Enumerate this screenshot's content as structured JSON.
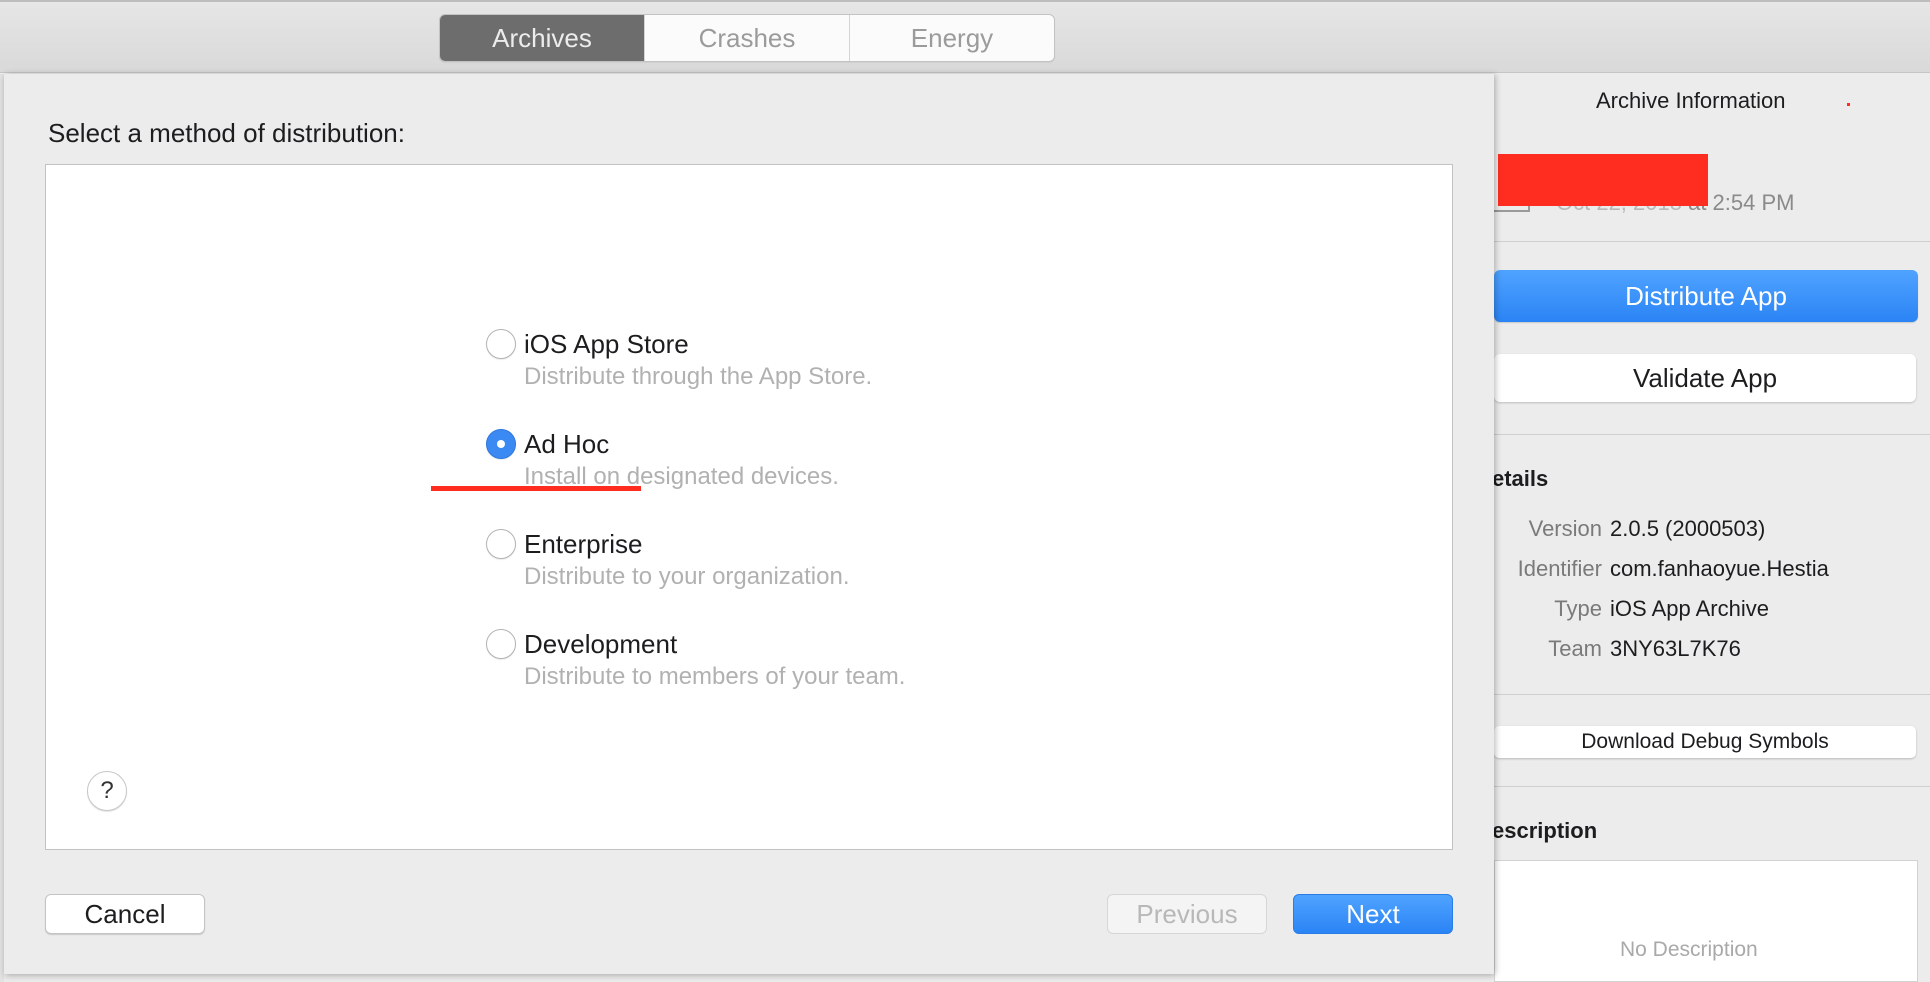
{
  "toolbar": {
    "tabs": [
      {
        "label": "Archives",
        "active": true
      },
      {
        "label": "Crashes",
        "active": false
      },
      {
        "label": "Energy",
        "active": false
      }
    ]
  },
  "sheet": {
    "title": "Select a method of distribution:",
    "options": [
      {
        "title": "iOS App Store",
        "description": "Distribute through the App Store.",
        "selected": false
      },
      {
        "title": "Ad Hoc",
        "description": "Install on designated devices.",
        "selected": true
      },
      {
        "title": "Enterprise",
        "description": "Distribute to your organization.",
        "selected": false
      },
      {
        "title": "Development",
        "description": "Distribute to members of your team.",
        "selected": false
      }
    ],
    "help_label": "?",
    "cancel_label": "Cancel",
    "previous_label": "Previous",
    "next_label": "Next"
  },
  "archive_panel": {
    "title": "Archive Information",
    "date_visible": "at 2:54 PM",
    "distribute_label": "Distribute App",
    "validate_label": "Validate App",
    "details_heading": "etails",
    "details": [
      {
        "label": "Version",
        "value": "2.0.5 (2000503)"
      },
      {
        "label": "Identifier",
        "value": "com.fanhaoyue.Hestia"
      },
      {
        "label": "Type",
        "value": "iOS App Archive"
      },
      {
        "label": "Team",
        "value": "3NY63L7K76"
      }
    ],
    "debug_symbols_label": "Download Debug Symbols",
    "description_heading": "escription",
    "no_description": "No Description"
  },
  "colors": {
    "accent_blue": "#2b84f5",
    "annotation_red": "#ff2d20"
  },
  "icons": {
    "help": "question-icon",
    "radio": "radio-icon"
  }
}
